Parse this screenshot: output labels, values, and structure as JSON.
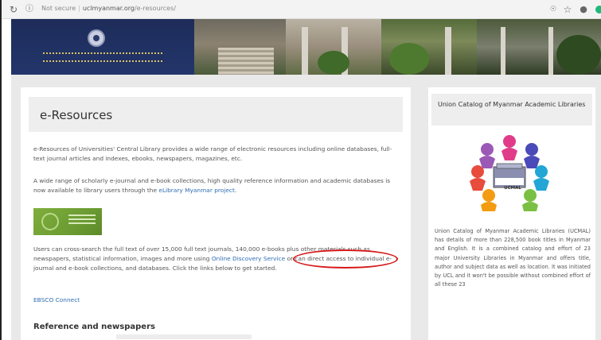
{
  "browser": {
    "security_label": "Not secure",
    "url_domain": "uclmyanmar.org",
    "url_path": "/e-resources/",
    "icons": [
      "reload-icon",
      "info-icon",
      "translate-icon",
      "star-icon",
      "account-icon"
    ]
  },
  "banner": {
    "logo_alt": "university-seal"
  },
  "main": {
    "title": "e-Resources",
    "para1": "e-Resources of Universities' Central Library provides a wide range of electronic resources including online databases, full-text journal articles and indexes, ebooks, newspapers, magazines, etc.",
    "para2_pre": "A wide range of scholarly e-journal and e-book collections, high quality reference information and academic databases is now available to library users through the ",
    "para2_link": "eLibrary Myanmar project",
    "para2_post": ".",
    "para3_pre": "Users can cross-search the full text of over 15,000 full text journals, 140,000 e-books plus other materials such as newspapers, statistical information, images and more using ",
    "para3_link": "Online Discovery Service",
    "para3_post": " or can direct access to individual e-journal and e-book collections, and databases. Click the links below to get started.",
    "ebsco_link": "EBSCO Connect",
    "section_heading": "Reference and newspapers"
  },
  "sidebar": {
    "title": "Union Catalog of Myanmar Academic Libraries",
    "logo_text": "UCMAL",
    "description": "Union Catalog of Myanmar Academic Libraries (UCMAL) has details of more than 228,500 book titles in Myanmar and English. It is a combined catalog and effort of 23 major University Libraries in Myanmar and offers title, author and subject data as well as location. It was initiated by UCL and it won't be possible without combined effort of all these 23"
  },
  "colors": {
    "link": "#2e6db4",
    "annotation_circle": "#d71a1a",
    "page_background": "#e9e9e9",
    "banner": "#1e2a4a"
  }
}
